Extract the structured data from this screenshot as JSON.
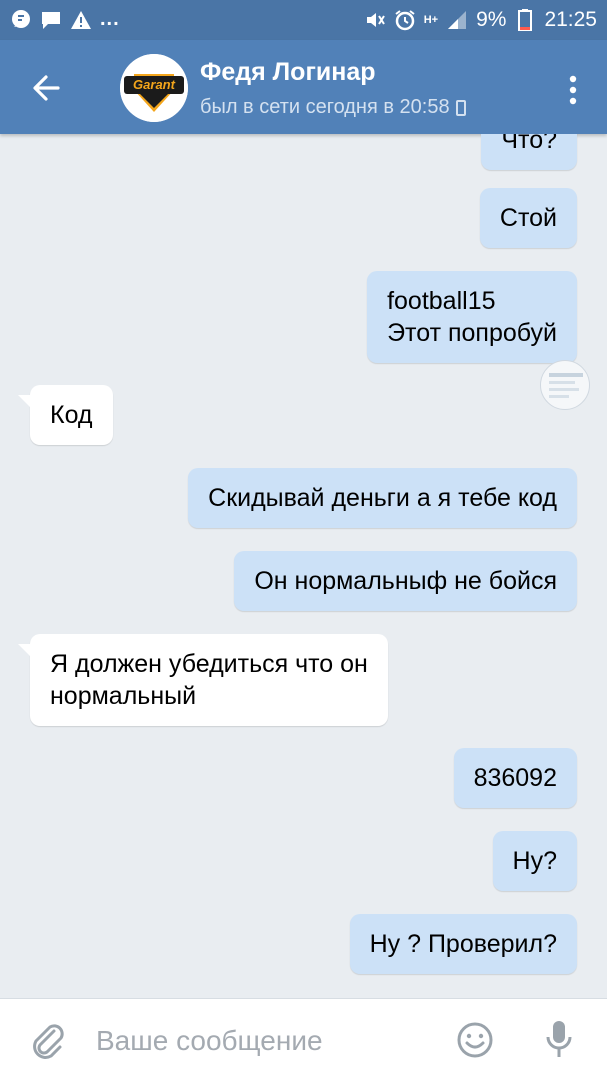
{
  "status_bar": {
    "network": "H+",
    "battery": "9%",
    "time": "21:25",
    "dots": "..."
  },
  "header": {
    "avatar_text": "Garant",
    "name": "Федя Логинар",
    "status": "был в сети сегодня в 20:58"
  },
  "messages": [
    {
      "side": "out",
      "text": "Что?"
    },
    {
      "side": "out",
      "text": "Стой"
    },
    {
      "side": "out",
      "text": "football15\nЭтот попробуй"
    },
    {
      "side": "in",
      "text": "Код"
    },
    {
      "side": "out",
      "text": "Скидывай деньги а я тебе код"
    },
    {
      "side": "out",
      "text": "Он нормальныф не бойся"
    },
    {
      "side": "in",
      "text": "Я должен убедиться что он\nнормальный"
    },
    {
      "side": "out",
      "text": "836092"
    },
    {
      "side": "out",
      "text": "Ну?"
    },
    {
      "side": "out",
      "text": "Ну ? Проверил?"
    }
  ],
  "composer": {
    "placeholder": "Ваше сообщение"
  },
  "colors": {
    "header": "#5181b8",
    "statusbar": "#4a75a6",
    "outgoing_bubble": "#cce1f7",
    "incoming_bubble": "#ffffff",
    "background": "#e9edf1"
  }
}
